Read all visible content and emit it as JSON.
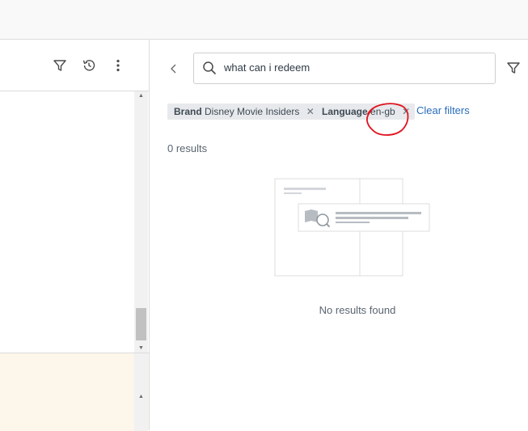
{
  "search": {
    "query": "what can i redeem"
  },
  "filters": {
    "chips": [
      {
        "label": "Brand",
        "value": "Disney Movie Insiders"
      },
      {
        "label": "Language",
        "value": "en-gb"
      }
    ],
    "clear_label": "Clear filters"
  },
  "results": {
    "count_text": "0 results",
    "empty_text": "No results found"
  },
  "icons": {
    "filter": "filter-icon",
    "history": "history-icon",
    "more": "more-vertical-icon",
    "back": "chevron-left-icon",
    "search": "search-icon",
    "close": "close-icon"
  },
  "colors": {
    "link": "#2a6ebb",
    "annotation": "#e0121d",
    "chip_bg": "#e7e9ec"
  }
}
